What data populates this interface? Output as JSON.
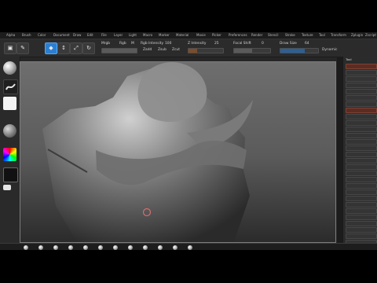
{
  "menu": {
    "items": [
      "Alpha",
      "Brush",
      "Color",
      "Document",
      "Draw",
      "Edit",
      "File",
      "Layer",
      "Light",
      "Macro",
      "Marker",
      "Material",
      "Movie",
      "Picker",
      "Preferences",
      "Render",
      "Stencil",
      "Stroke",
      "Texture",
      "Tool",
      "Transform",
      "Zplugin",
      "Zscript"
    ]
  },
  "top_controls": {
    "buttons": {
      "edit": "Edit",
      "draw": "Draw",
      "move": "Move",
      "scale": "Scale",
      "rotate": "Rotate"
    },
    "labels": {
      "mrgb": "Mrgb",
      "rgb": "Rgb",
      "m": "M",
      "zadd": "Zadd",
      "zsub": "Zsub",
      "zcut": "Zcut",
      "focal_shift": "Focal Shift",
      "draw_size": "Draw Size",
      "dynamic": "Dynamic",
      "rgb_intensity": "Rgb Intensity",
      "z_intensity": "Z Intensity"
    },
    "values": {
      "focal_shift": "0",
      "draw_size": "64",
      "rgb_intensity": "100",
      "z_intensity": "25"
    }
  },
  "right_shelf": {
    "title": "Tool",
    "items": [
      "Load Tool",
      "Save As",
      "Copy Tool",
      "Paste Tool",
      "Import",
      "Export",
      "Clone",
      "Make PolyMesh3D",
      "GoZ",
      "All",
      "Visible",
      "R",
      "Lightbox > Tools",
      "Subtool",
      "Geometry",
      "ArrayMesh",
      "NanoMesh",
      "Layers",
      "FiberMesh",
      "Geometry HD",
      "Preview",
      "Surface",
      "Deformation",
      "Masking",
      "Visibility",
      "Polygroups",
      "Contact",
      "Morph Target",
      "Polypaint",
      "UV Map",
      "Texture Map",
      "Displacement Map",
      "Normal Map",
      "Vector Displacement Map",
      "Display Properties",
      "Unified Skin",
      "Initialize",
      "Import",
      "Export"
    ]
  },
  "colors": {
    "accent_blue": "#2a7fd2",
    "accent_orange": "#7d4c2a",
    "panel_bg": "#2b2b2b",
    "viewport_top": "#6e6e6e",
    "viewport_bottom": "#2b2b2b"
  }
}
